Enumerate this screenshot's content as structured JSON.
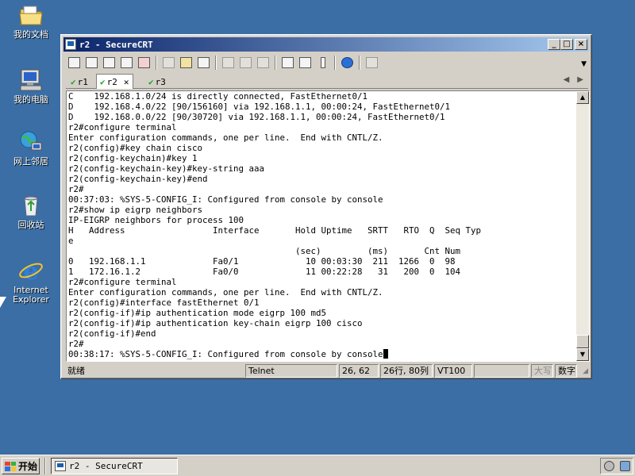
{
  "desktop": {
    "icons": [
      {
        "name": "my-documents",
        "label": "我的文档"
      },
      {
        "name": "my-computer",
        "label": "我的电脑"
      },
      {
        "name": "network-places",
        "label": "网上邻居"
      },
      {
        "name": "recycle-bin",
        "label": "回收站"
      },
      {
        "name": "internet-explorer",
        "label": "Internet Explorer"
      }
    ]
  },
  "window": {
    "title": "r2 - SecureCRT",
    "controls": {
      "minimize": "_",
      "maximize": "□",
      "close": "×"
    }
  },
  "tabs": [
    {
      "label": "r1",
      "active": false
    },
    {
      "label": "r2",
      "active": true
    },
    {
      "label": "r3",
      "active": false
    }
  ],
  "terminal": {
    "lines": [
      "C    192.168.1.0/24 is directly connected, FastEthernet0/1",
      "D    192.168.4.0/22 [90/156160] via 192.168.1.1, 00:00:24, FastEthernet0/1",
      "D    192.168.0.0/22 [90/30720] via 192.168.1.1, 00:00:24, FastEthernet0/1",
      "r2#configure terminal",
      "Enter configuration commands, one per line.  End with CNTL/Z.",
      "r2(config)#key chain cisco",
      "r2(config-keychain)#key 1",
      "r2(config-keychain-key)#key-string aaa",
      "r2(config-keychain-key)#end",
      "r2#",
      "00:37:03: %SYS-5-CONFIG_I: Configured from console by console",
      "r2#show ip eigrp neighbors",
      "IP-EIGRP neighbors for process 100",
      "H   Address                 Interface       Hold Uptime   SRTT   RTO  Q  Seq Typ",
      "e",
      "                                            (sec)         (ms)       Cnt Num",
      "0   192.168.1.1             Fa0/1             10 00:03:30  211  1266  0  98",
      "1   172.16.1.2              Fa0/0             11 00:22:28   31   200  0  104",
      "r2#configure terminal",
      "Enter configuration commands, one per line.  End with CNTL/Z.",
      "r2(config)#interface fastEthernet 0/1",
      "r2(config-if)#ip authentication mode eigrp 100 md5",
      "r2(config-if)#ip authentication key-chain eigrp 100 cisco",
      "r2(config-if)#end",
      "r2#",
      "00:38:17: %SYS-5-CONFIG_I: Configured from console by console"
    ]
  },
  "statusbar": {
    "ready": "就绪",
    "protocol": "Telnet",
    "position": "26, 62",
    "size": "26行, 80列",
    "emulation": "VT100",
    "caps": "大写",
    "num": "数字"
  },
  "taskbar": {
    "start_label": "开始",
    "task_label": "r2 - SecureCRT"
  },
  "colors": {
    "desktop": "#3a6ea5",
    "title_active": "#0a246a",
    "check": "#2ca02c"
  }
}
